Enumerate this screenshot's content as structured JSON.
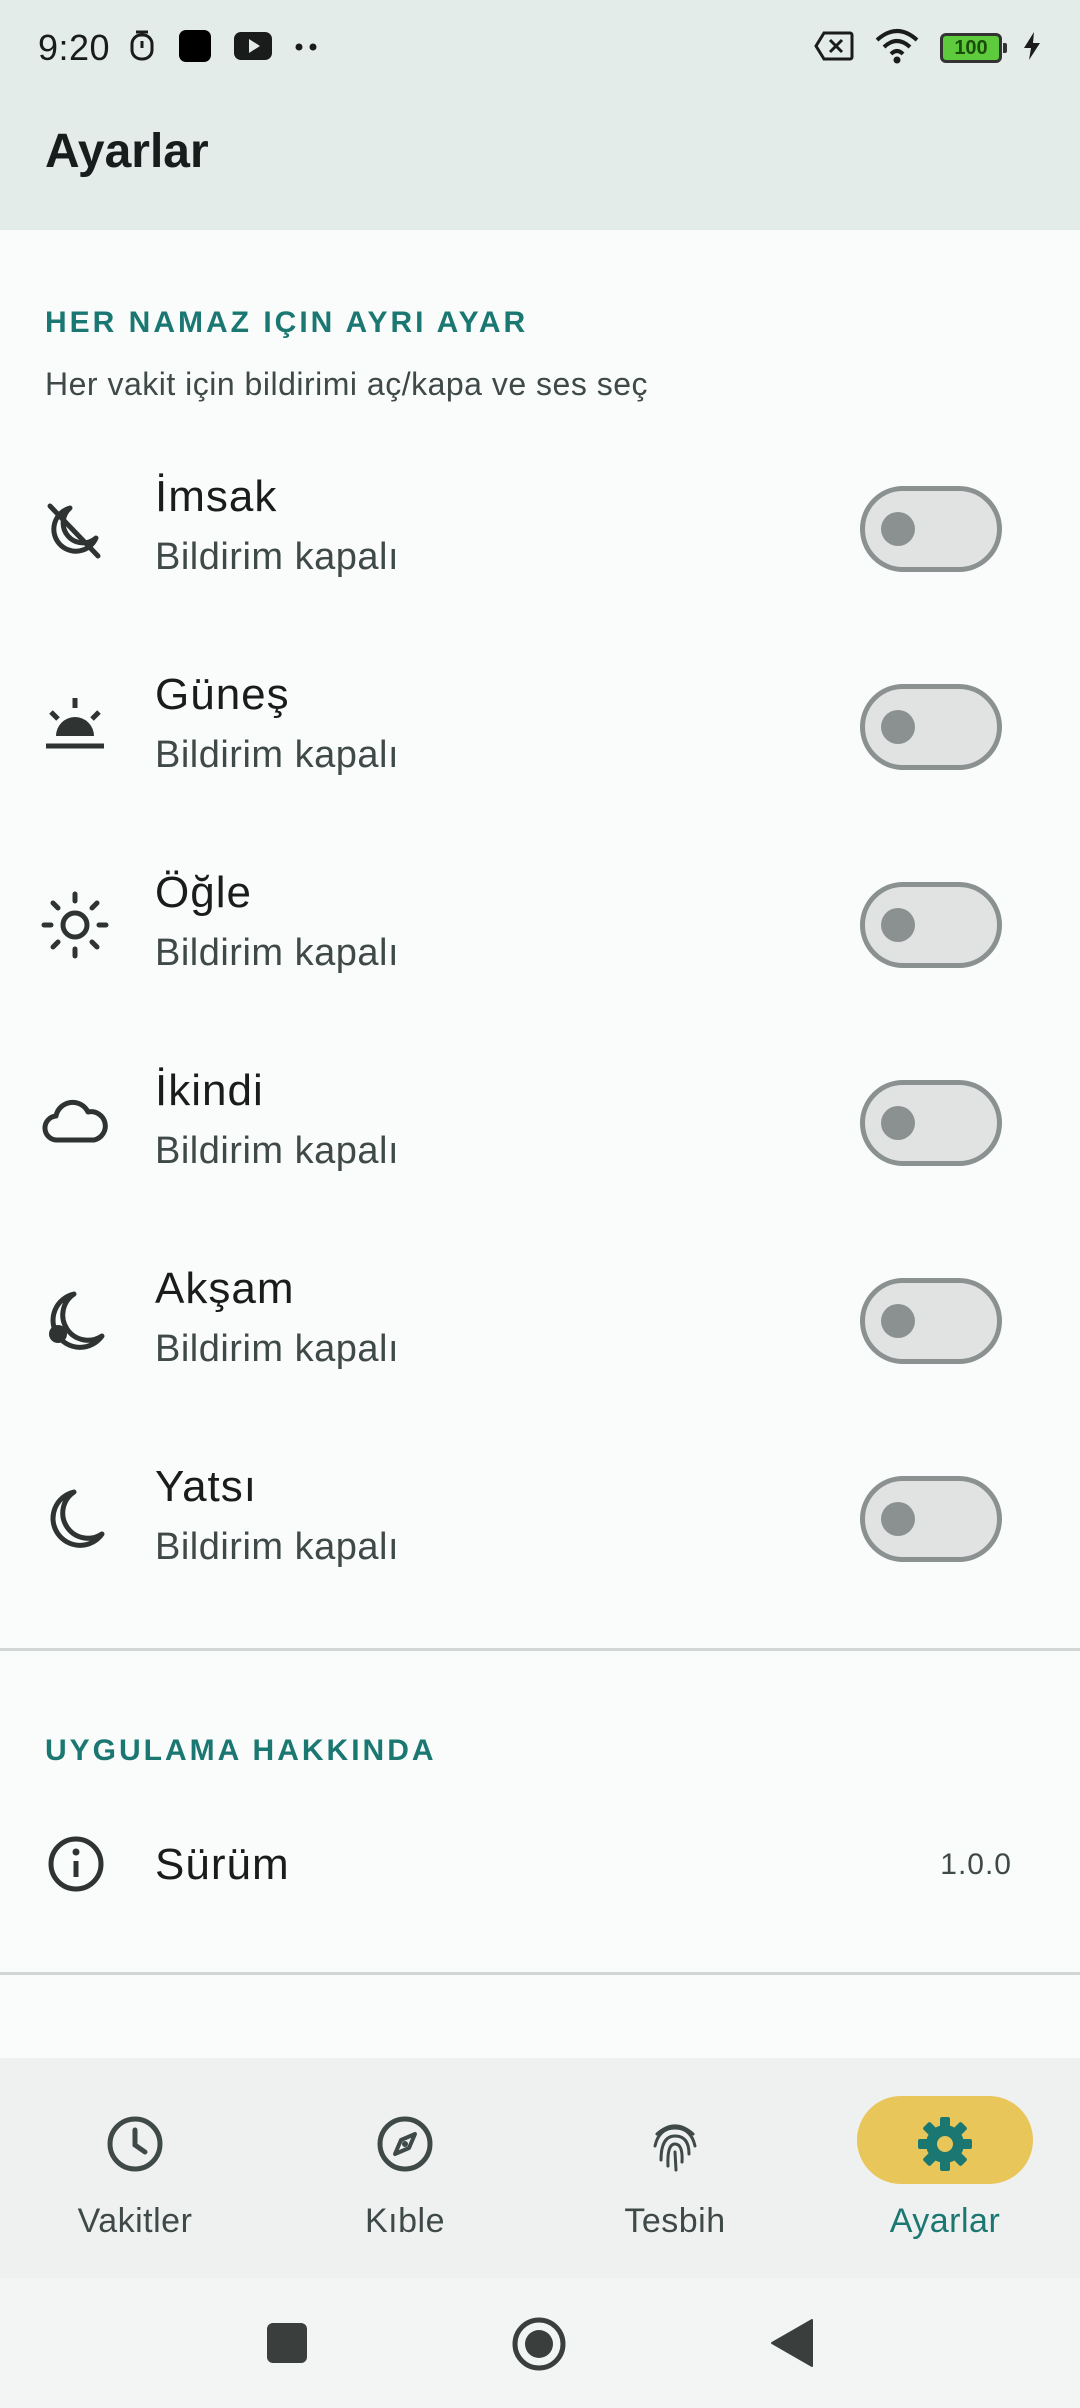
{
  "status_bar": {
    "time": "9:20",
    "battery_level": "100",
    "icons": [
      "alarm-clock-icon",
      "app-square-icon",
      "youtube-icon",
      "more-dots-icon",
      "sim-off-icon",
      "wifi-icon",
      "battery-icon",
      "charging-bolt-icon"
    ]
  },
  "app_bar": {
    "title": "Ayarlar"
  },
  "prayer_section": {
    "header": "HER NAMAZ IÇIN AYRI AYAR",
    "subtitle": "Her vakit için bildirimi aç/kapa ve ses seç",
    "items": [
      {
        "name": "İmsak",
        "status": "Bildirim kapalı",
        "icon": "moon-off-icon",
        "enabled": false
      },
      {
        "name": "Güneş",
        "status": "Bildirim kapalı",
        "icon": "sunrise-icon",
        "enabled": false
      },
      {
        "name": "Öğle",
        "status": "Bildirim kapalı",
        "icon": "sun-icon",
        "enabled": false
      },
      {
        "name": "İkindi",
        "status": "Bildirim kapalı",
        "icon": "cloud-icon",
        "enabled": false
      },
      {
        "name": "Akşam",
        "status": "Bildirim kapalı",
        "icon": "moon-stars-icon",
        "enabled": false
      },
      {
        "name": "Yatsı",
        "status": "Bildirim kapalı",
        "icon": "moon-icon",
        "enabled": false
      }
    ]
  },
  "about_section": {
    "header": "UYGULAMA HAKKINDA",
    "version_label": "Sürüm",
    "version_value": "1.0.0"
  },
  "bottom_nav": {
    "items": [
      {
        "label": "Vakitler",
        "icon": "clock-icon",
        "selected": false
      },
      {
        "label": "Kıble",
        "icon": "compass-icon",
        "selected": false
      },
      {
        "label": "Tesbih",
        "icon": "fingerprint-icon",
        "selected": false
      },
      {
        "label": "Ayarlar",
        "icon": "gear-icon",
        "selected": true
      }
    ],
    "colors": {
      "indicator": "#E9C659",
      "selected": "#1A7771",
      "unselected": "#3F4948"
    }
  },
  "colors": {
    "accent": "#1A7771",
    "app_bar_bg": "#E4ECEA",
    "background": "#F9FCFB",
    "toggle_off": "#8A9190"
  }
}
